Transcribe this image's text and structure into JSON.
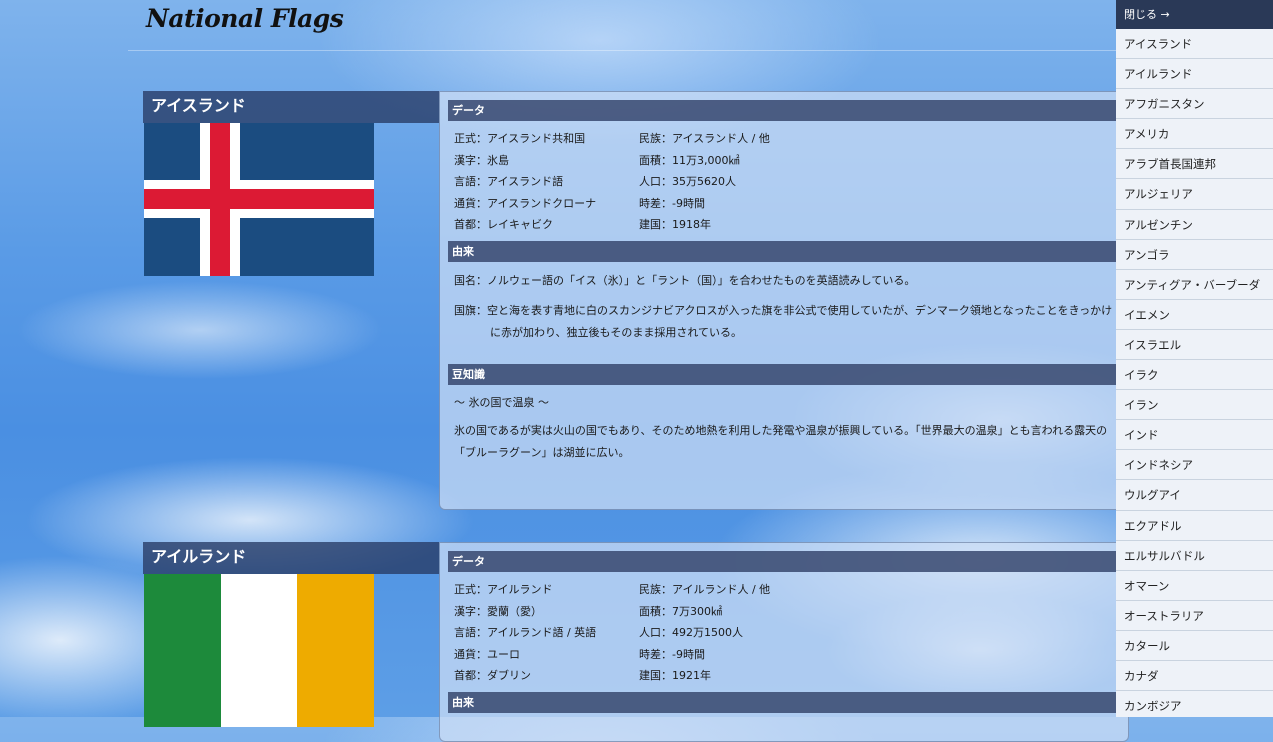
{
  "site": {
    "title": "National Flags"
  },
  "sidebar": {
    "close_label": "閉じる →",
    "items": [
      "アイスランド",
      "アイルランド",
      "アフガニスタン",
      "アメリカ",
      "アラブ首長国連邦",
      "アルジェリア",
      "アルゼンチン",
      "アンゴラ",
      "アンティグア・バーブーダ",
      "イエメン",
      "イスラエル",
      "イラク",
      "イラン",
      "インド",
      "インドネシア",
      "ウルグアイ",
      "エクアドル",
      "エルサルバドル",
      "オマーン",
      "オーストラリア",
      "カタール",
      "カナダ",
      "カンボジア"
    ]
  },
  "countries": [
    {
      "name": "アイスランド",
      "flag_colors": {
        "field": "#1b4c80",
        "cross_outer": "#ffffff",
        "cross_inner": "#dc1a34"
      },
      "data_heading": "データ",
      "facts_left": [
        "正式：アイスランド共和国",
        "漢字：氷島",
        "言語：アイスランド語",
        "通貨：アイスランドクローナ",
        "首都：レイキャビク"
      ],
      "facts_right": [
        "民族：アイスランド人 / 他",
        "面積：11万3,000㎢",
        "人口：35万5620人",
        "時差：-9時間",
        "建国：1918年"
      ],
      "origin_heading": "由来",
      "origin_name": "国名：ノルウェー語の「イス（氷）」と「ラント（国）」を合わせたものを英語読みしている。",
      "origin_flag": "国旗：空と海を表す青地に白のスカンジナビアクロスが入った旗を非公式で使用していたが、デンマーク領地となったことをきっかけに赤が加わり、独立後もそのまま採用されている。",
      "trivia_heading": "豆知識",
      "trivia_title": "〜 氷の国で温泉 〜",
      "trivia_body": "氷の国であるが実は火山の国でもあり、そのため地熱を利用した発電や温泉が振興している。「世界最大の温泉」とも言われる露天の「ブルーラグーン」は湖並に広い。"
    },
    {
      "name": "アイルランド",
      "flag_colors": {
        "green": "#1d8a3b",
        "white": "#ffffff",
        "orange": "#eeab00"
      },
      "data_heading": "データ",
      "facts_left": [
        "正式：アイルランド",
        "漢字：愛蘭（愛）",
        "言語：アイルランド語 / 英語",
        "通貨：ユーロ",
        "首都：ダブリン"
      ],
      "facts_right": [
        "民族：アイルランド人 / 他",
        "面積：7万300㎢",
        "人口：492万1500人",
        "時差：-9時間",
        "建国：1921年"
      ],
      "origin_heading": "由来"
    }
  ]
}
